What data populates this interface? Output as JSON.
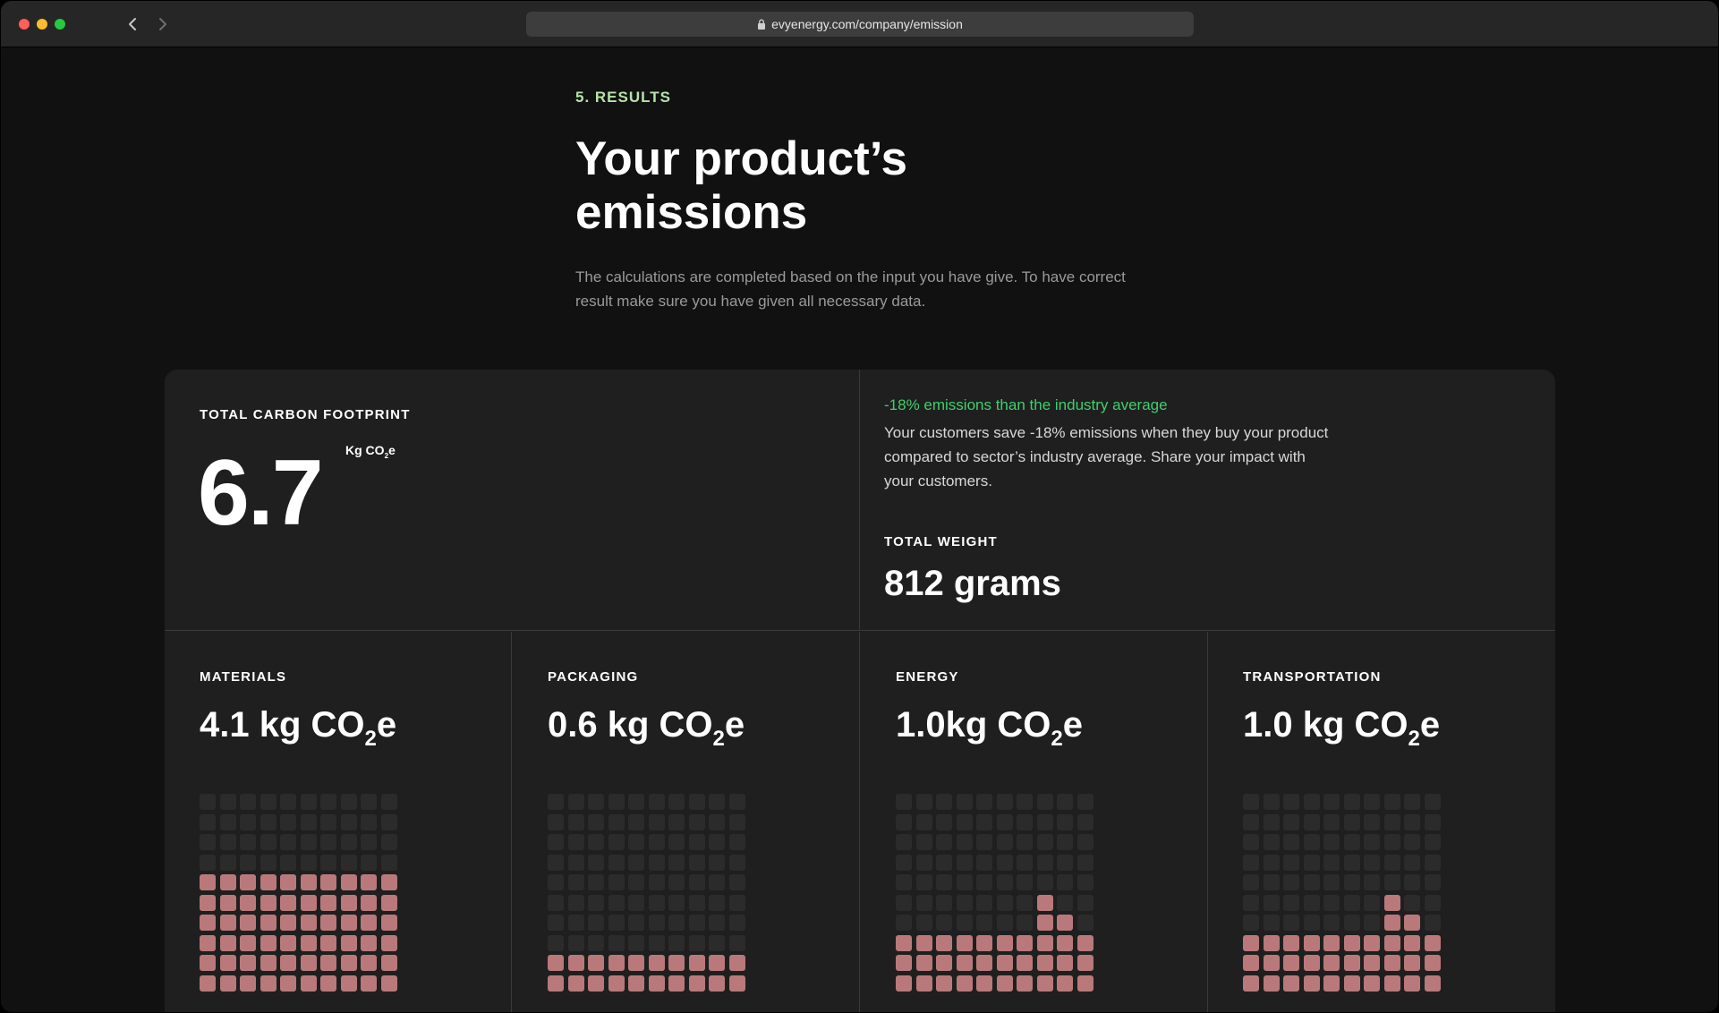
{
  "browser": {
    "url": "evyenergy.com/company/emission",
    "icons": {
      "back": "chevron-left-icon",
      "forward": "chevron-right-icon",
      "lock": "lock-icon"
    }
  },
  "header": {
    "step": "5. RESULTS",
    "title": "Your product’s emissions",
    "description": "The calculations are completed based on the input you have give. To have correct result make sure you have given all necessary data."
  },
  "summary": {
    "total_label": "TOTAL CARBON FOOTPRINT",
    "total_value": "6.7",
    "total_unit_prefix": "Kg CO",
    "total_unit_sub": "2",
    "total_unit_suffix": "e",
    "comparison_title": "-18% emissions than the industry average",
    "comparison_text": "Your customers save -18% emissions when they buy your product compared to sector’s industry average. Share your impact with your customers.",
    "weight_label": "TOTAL WEIGHT",
    "weight_value": "812 grams"
  },
  "categories": [
    {
      "label": "MATERIALS",
      "value_prefix": "4.1 kg CO",
      "value_sub": "2",
      "value_suffix": "e",
      "filled_per_column": [
        6,
        6,
        6,
        6,
        6,
        6,
        6,
        6,
        6,
        6
      ]
    },
    {
      "label": "PACKAGING",
      "value_prefix": "0.6 kg CO",
      "value_sub": "2",
      "value_suffix": "e",
      "filled_per_column": [
        2,
        2,
        2,
        2,
        2,
        2,
        2,
        2,
        2,
        2
      ]
    },
    {
      "label": "ENERGY",
      "value_prefix": "1.0kg CO",
      "value_sub": "2",
      "value_suffix": "e",
      "filled_per_column": [
        3,
        3,
        3,
        3,
        3,
        3,
        3,
        5,
        4,
        3
      ]
    },
    {
      "label": "TRANSPORTATION",
      "value_prefix": "1.0 kg CO",
      "value_sub": "2",
      "value_suffix": "e",
      "filled_per_column": [
        3,
        3,
        3,
        3,
        3,
        3,
        3,
        5,
        4,
        3
      ]
    }
  ],
  "colors": {
    "accent_green": "#3ecf6e",
    "step_green": "#b5e3a8",
    "filled_cell": "#b9797a",
    "empty_cell": "#2b2b2b"
  }
}
